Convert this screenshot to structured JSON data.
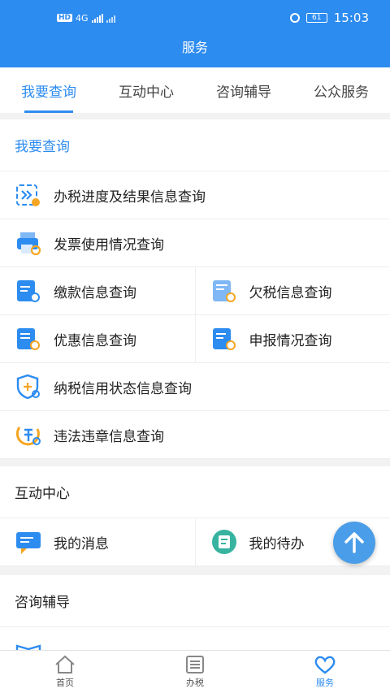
{
  "status_bar": {
    "network": "HD",
    "signal": "4G",
    "battery": "61",
    "time": "15:03"
  },
  "header": {
    "title": "服务"
  },
  "tabs": [
    {
      "label": "我要查询",
      "active": true
    },
    {
      "label": "互动中心",
      "active": false
    },
    {
      "label": "咨询辅导",
      "active": false
    },
    {
      "label": "公众服务",
      "active": false
    }
  ],
  "query_section": {
    "title": "我要查询",
    "items": {
      "progress": "办税进度及结果信息查询",
      "invoice": "发票使用情况查询",
      "payment": "缴款信息查询",
      "arrears": "欠税信息查询",
      "preference": "优惠信息查询",
      "declaration": "申报情况查询",
      "credit": "纳税信用状态信息查询",
      "violation": "违法违章信息查询"
    }
  },
  "interaction_section": {
    "title": "互动中心",
    "items": {
      "messages": "我的消息",
      "todo": "我的待办"
    }
  },
  "consult_section": {
    "title": "咨询辅导"
  },
  "bottom_nav": [
    {
      "label": "首页",
      "active": false
    },
    {
      "label": "办税",
      "active": false
    },
    {
      "label": "服务",
      "active": true
    }
  ],
  "colors": {
    "primary": "#2d8cf0",
    "accent": "#f5a623"
  }
}
